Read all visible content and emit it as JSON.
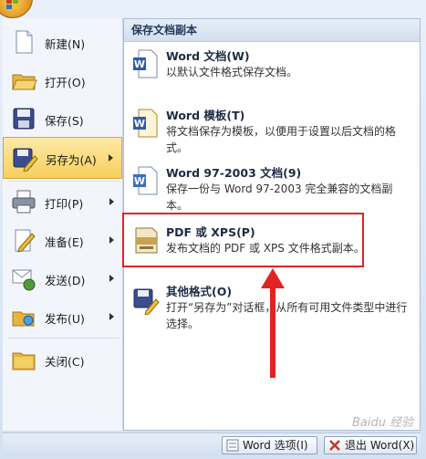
{
  "menu": {
    "items": [
      {
        "label": "新建(N)",
        "icon": "new-document-icon"
      },
      {
        "label": "打开(O)",
        "icon": "open-folder-icon"
      },
      {
        "label": "保存(S)",
        "icon": "save-disk-icon"
      },
      {
        "label": "另存为(A)",
        "icon": "save-as-icon",
        "submenu": true,
        "active": true
      },
      {
        "label": "打印(P)",
        "icon": "printer-icon",
        "submenu": true
      },
      {
        "label": "准备(E)",
        "icon": "prepare-icon",
        "submenu": true
      },
      {
        "label": "发送(D)",
        "icon": "send-icon",
        "submenu": true
      },
      {
        "label": "发布(U)",
        "icon": "publish-icon",
        "submenu": true
      },
      {
        "label": "关闭(C)",
        "icon": "close-folder-icon"
      }
    ]
  },
  "save_as": {
    "header": "保存文档副本",
    "options": [
      {
        "title": "Word 文档(W)",
        "desc": "以默认文件格式保存文档。",
        "icon": "word-document-icon"
      },
      {
        "title": "Word 模板(T)",
        "desc": "将文档保存为模板，以便用于设置以后文档的格式。",
        "icon": "word-template-icon"
      },
      {
        "title": "Word 97-2003 文档(9)",
        "desc": "保存一份与 Word 97-2003 完全兼容的文档副本。",
        "icon": "word-97-2003-icon"
      },
      {
        "title": "PDF 或 XPS(P)",
        "desc": "发布文档的 PDF 或 XPS 文件格式副本。",
        "icon": "pdf-xps-icon"
      },
      {
        "title": "其他格式(O)",
        "desc": "打开“另存为”对话框，从所有可用文件类型中进行选择。",
        "icon": "other-formats-icon"
      }
    ]
  },
  "bottom": {
    "options_label": "Word 选项(I)",
    "exit_label": "退出 Word(X)"
  },
  "watermark": "Baidu 经验",
  "colors": {
    "highlight": "#e02424",
    "active_item": "#f8cf5c"
  }
}
